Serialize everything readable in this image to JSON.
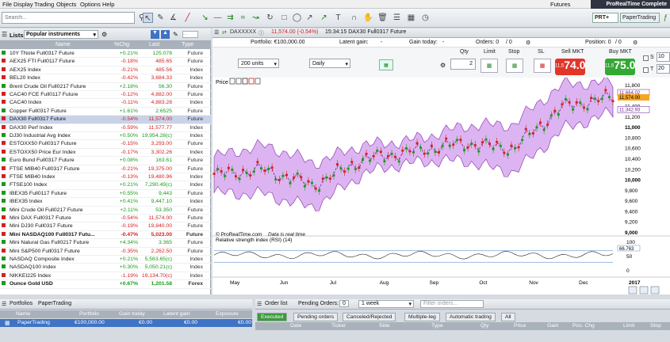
{
  "menu": {
    "items": [
      "File",
      "Display",
      "Trading",
      "Objects",
      "Options",
      "Help"
    ],
    "futures": "Futures",
    "brand": "ProRealTime Complete"
  },
  "toolbar": {
    "search_placeholder": "Search...",
    "prt_label": "PRT+",
    "papertrading_label": "PaperTrading"
  },
  "lists": {
    "title": "Lists",
    "selected_list": "Popular instruments",
    "columns": [
      "Name",
      "%Chg",
      "Last",
      "Type"
    ],
    "rows": [
      {
        "name": "10Y TNote Full0317 Future",
        "chg": "+0.21%",
        "last": "125.078",
        "type": "Future",
        "dir": "up"
      },
      {
        "name": "AEX25 FTI Full0117 Future",
        "chg": "-0.18%",
        "last": "485.65",
        "type": "Future",
        "dir": "dn"
      },
      {
        "name": "AEX25 Index",
        "chg": "-0.21%",
        "last": "485.56",
        "type": "Index",
        "dir": "dn"
      },
      {
        "name": "BEL20 Index",
        "chg": "-0.42%",
        "last": "3,684.33",
        "type": "Index",
        "dir": "dn"
      },
      {
        "name": "Brent Crude Oil Full0217 Future",
        "chg": "+2.18%",
        "last": "56.30",
        "type": "Future",
        "dir": "up"
      },
      {
        "name": "CAC40 FCE Full0117 Future",
        "chg": "-0.12%",
        "last": "4,882.00",
        "type": "Future",
        "dir": "dn"
      },
      {
        "name": "CAC40 Index",
        "chg": "-0.11%",
        "last": "4,883.28",
        "type": "Index",
        "dir": "dn"
      },
      {
        "name": "Copper Full0317 Future",
        "chg": "+1.61%",
        "last": "2.6525",
        "type": "Future",
        "dir": "up"
      },
      {
        "name": "DAX30 Full0317 Future",
        "chg": "-0.54%",
        "last": "11,574.00",
        "type": "Future",
        "dir": "dn",
        "selected": true
      },
      {
        "name": "DAX30 Perf Index",
        "chg": "-0.59%",
        "last": "11,577.77",
        "type": "Index",
        "dir": "dn"
      },
      {
        "name": "DJ30 Industrial Avg Index",
        "chg": "+0.50%",
        "last": "19,954.28(c)",
        "type": "Index",
        "dir": "up"
      },
      {
        "name": "ESTOXX50 Full0317 Future",
        "chg": "-0.15%",
        "last": "3,293.00",
        "type": "Future",
        "dir": "dn"
      },
      {
        "name": "ESTOXX50 Price Eur Index",
        "chg": "-0.17%",
        "last": "3,302.26",
        "type": "Index",
        "dir": "dn"
      },
      {
        "name": "Euro Bund Full0317 Future",
        "chg": "+0.08%",
        "last": "163.61",
        "type": "Future",
        "dir": "up"
      },
      {
        "name": "FTSE MIB40 Full0317 Future",
        "chg": "-0.21%",
        "last": "19,375.00",
        "type": "Future",
        "dir": "dn"
      },
      {
        "name": "FTSE MIB40 Index",
        "chg": "-0.13%",
        "last": "19,480.96",
        "type": "Index",
        "dir": "dn"
      },
      {
        "name": "FTSE100 Index",
        "chg": "+0.21%",
        "last": "7,290.49(c)",
        "type": "Index",
        "dir": "up"
      },
      {
        "name": "IBEX35 Full0117 Future",
        "chg": "+0.55%",
        "last": "9,443",
        "type": "Future",
        "dir": "up"
      },
      {
        "name": "IBEX35 Index",
        "chg": "+0.41%",
        "last": "9,447.10",
        "type": "Index",
        "dir": "up"
      },
      {
        "name": "Mini Crude Oil Full0217 Future",
        "chg": "+2.11%",
        "last": "53.350",
        "type": "Future",
        "dir": "up"
      },
      {
        "name": "Mini DAX Full0317 Future",
        "chg": "-0.54%",
        "last": "11,574.00",
        "type": "Future",
        "dir": "dn"
      },
      {
        "name": "Mini DJ30 Full0317 Future",
        "chg": "-0.19%",
        "last": "19,840.00",
        "type": "Future",
        "dir": "dn"
      },
      {
        "name": "Mini NASDAQ100 Full0317 Futu...",
        "chg": "-0.47%",
        "last": "5,023.00",
        "type": "Future",
        "dir": "dn",
        "bold": true
      },
      {
        "name": "Mini Natural Gas Full0217 Future",
        "chg": "+4.34%",
        "last": "3.365",
        "type": "Future",
        "dir": "up"
      },
      {
        "name": "Mini S&P500 Full0317 Future",
        "chg": "-0.35%",
        "last": "2,262.50",
        "type": "Future",
        "dir": "dn"
      },
      {
        "name": "NASDAQ Composite Index",
        "chg": "+0.21%",
        "last": "5,563.65(c)",
        "type": "Index",
        "dir": "up"
      },
      {
        "name": "NASDAQ100 Index",
        "chg": "+0.30%",
        "last": "5,050.21(c)",
        "type": "Index",
        "dir": "up"
      },
      {
        "name": "NIKKEI225 Index",
        "chg": "-1.19%",
        "last": "19,134.70(c)",
        "type": "Index",
        "dir": "dn"
      },
      {
        "name": "Ounce Gold USD",
        "chg": "+0.67%",
        "last": "1,201.58",
        "type": "Forex",
        "dir": "up",
        "bold": true
      }
    ]
  },
  "chart": {
    "instrument": "DAXXXXX",
    "price_line": "11,574.00 (-0.54%)",
    "time_desc": "15:34:15 DAX30 Full0317 Future",
    "portfolio": "Portfolio: €100,000.00",
    "latent_gain": "Latent gain:",
    "latent_gain_val": "-",
    "gain_today": "Gain today:",
    "gain_today_val": "-",
    "orders": "Orders: 0",
    "orders_sep": "/ 0",
    "position": "Position: 0",
    "position_sep": "/ 0",
    "units": "200 units",
    "timeframe": "Daily",
    "qty_label": "Qty",
    "qty_val": "2",
    "limit_label": "Limit",
    "stop_label": "Stop",
    "sl_label": "SL",
    "sell_label": "Sell MKT",
    "buy_label": "Buy MKT",
    "sell_small": "11,5",
    "sell_big": "74.0",
    "buy_small": "11,5",
    "buy_big": "75.0",
    "s_label": "S",
    "s_val": "10",
    "t_label": "T",
    "t_val": "20",
    "price_panel": "Price",
    "watermark": "© ProRealTime.com",
    "realtime": "Data is real time",
    "rsi_label": "Relative strength index (RSI) (14)",
    "rsi_value": "66.763",
    "rsi_ticks": [
      "100",
      "50",
      "0"
    ],
    "y_ticks": [
      "11,800",
      "11,600",
      "11,400",
      "11,200",
      "11,000",
      "10,800",
      "10,600",
      "10,400",
      "10,200",
      "10,000",
      "9,800",
      "9,600",
      "9,400",
      "9,200",
      "9,000"
    ],
    "y_tag_high": "11,664.02",
    "y_tag_last": "11,574.00",
    "y_tag_low": "11,342.93",
    "x_ticks": [
      "May",
      "Jun",
      "Jul",
      "Aug",
      "Sep",
      "Oct",
      "Nov",
      "Dec",
      "2017"
    ]
  },
  "chart_data": {
    "type": "line",
    "title": "DAX30 Full0317 Future",
    "ylim": [
      9000,
      11800
    ],
    "x": [
      "May",
      "Jun",
      "Jul",
      "Aug",
      "Sep",
      "Oct",
      "Nov",
      "Dec",
      "2017"
    ],
    "series": [
      {
        "values": [
          10100,
          10200,
          9900,
          10400,
          10550,
          10700,
          10600,
          11400,
          11574
        ]
      }
    ]
  },
  "portfolio": {
    "tabs": [
      "Portfolios",
      "PaperTrading"
    ],
    "columns": [
      "Name",
      "Portfolio",
      "Gain today",
      "Latent gain",
      "Exposure"
    ],
    "row": {
      "name": "PaperTrading",
      "portfolio": "€100,000.00",
      "gain": "€0.00",
      "latent": "€0.00",
      "exposure": "€0.00"
    }
  },
  "orders": {
    "title": "Order list",
    "pending_label": "Pending Orders:",
    "pending_count": "0",
    "period": "1 week",
    "filter_placeholder": "Filter orders...",
    "tabs": [
      "Executed",
      "Pending orders",
      "Canceled/Rejected",
      "Multiple-leg",
      "Automatic trading",
      "All"
    ],
    "columns": [
      "Date",
      "Ticker",
      "Side",
      "Type",
      "Qty",
      "Price",
      "Gain",
      "Pos. Chg",
      "Limit",
      "Stop"
    ]
  }
}
